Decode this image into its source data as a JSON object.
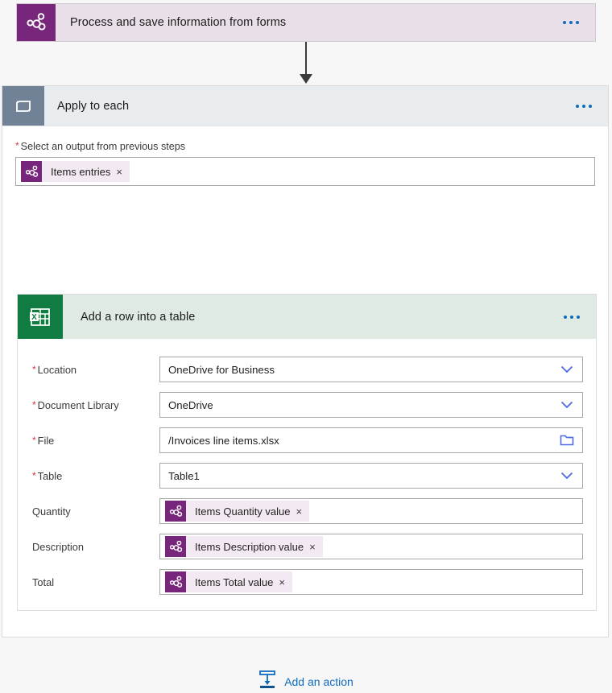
{
  "colors": {
    "forms_purple": "#77267c",
    "loop_gray": "#718296",
    "excel_green": "#107c41",
    "trigger_header_bg": "#e9dfe9",
    "scope_header_bg": "#e8ecef",
    "action_header_bg": "#dfeae2",
    "accent_blue": "#0f6cbd",
    "required_red": "#d13438",
    "canvas_bg": "#f7f7f7",
    "chip_bg": "#f3e9f3"
  },
  "trigger": {
    "title": "Process and save information from forms",
    "icon": "forms-molecule-icon",
    "menu_icon": "ellipsis-icon"
  },
  "connector": {
    "icon": "down-arrow-icon"
  },
  "scope": {
    "title": "Apply to each",
    "icon": "loop-icon",
    "menu_icon": "ellipsis-icon",
    "output_field": {
      "required": "*",
      "label": "Select an output from previous steps",
      "token": {
        "text": "Items entries",
        "remove_label": "×",
        "icon": "forms-molecule-icon"
      }
    }
  },
  "action": {
    "title": "Add a row into a table",
    "icon": "excel-table-icon",
    "menu_icon": "ellipsis-icon",
    "fields": [
      {
        "required": "*",
        "label": "Location",
        "type": "dropdown",
        "value": "OneDrive for Business",
        "trailing_icon": "chevron-down-icon"
      },
      {
        "required": "*",
        "label": "Document Library",
        "type": "dropdown",
        "value": "OneDrive",
        "trailing_icon": "chevron-down-icon"
      },
      {
        "required": "*",
        "label": "File",
        "type": "file-picker",
        "value": "/Invoices line items.xlsx",
        "trailing_icon": "folder-icon"
      },
      {
        "required": "*",
        "label": "Table",
        "type": "dropdown",
        "value": "Table1",
        "trailing_icon": "chevron-down-icon"
      },
      {
        "required": "",
        "label": "Quantity",
        "type": "token",
        "token": {
          "text": "Items Quantity value",
          "remove_label": "×",
          "icon": "forms-molecule-icon"
        }
      },
      {
        "required": "",
        "label": "Description",
        "type": "token",
        "token": {
          "text": "Items Description value",
          "remove_label": "×",
          "icon": "forms-molecule-icon"
        }
      },
      {
        "required": "",
        "label": "Total",
        "type": "token",
        "token": {
          "text": "Items Total value",
          "remove_label": "×",
          "icon": "forms-molecule-icon"
        }
      }
    ]
  },
  "add_action": {
    "label": "Add an action",
    "icon": "insert-action-icon"
  }
}
